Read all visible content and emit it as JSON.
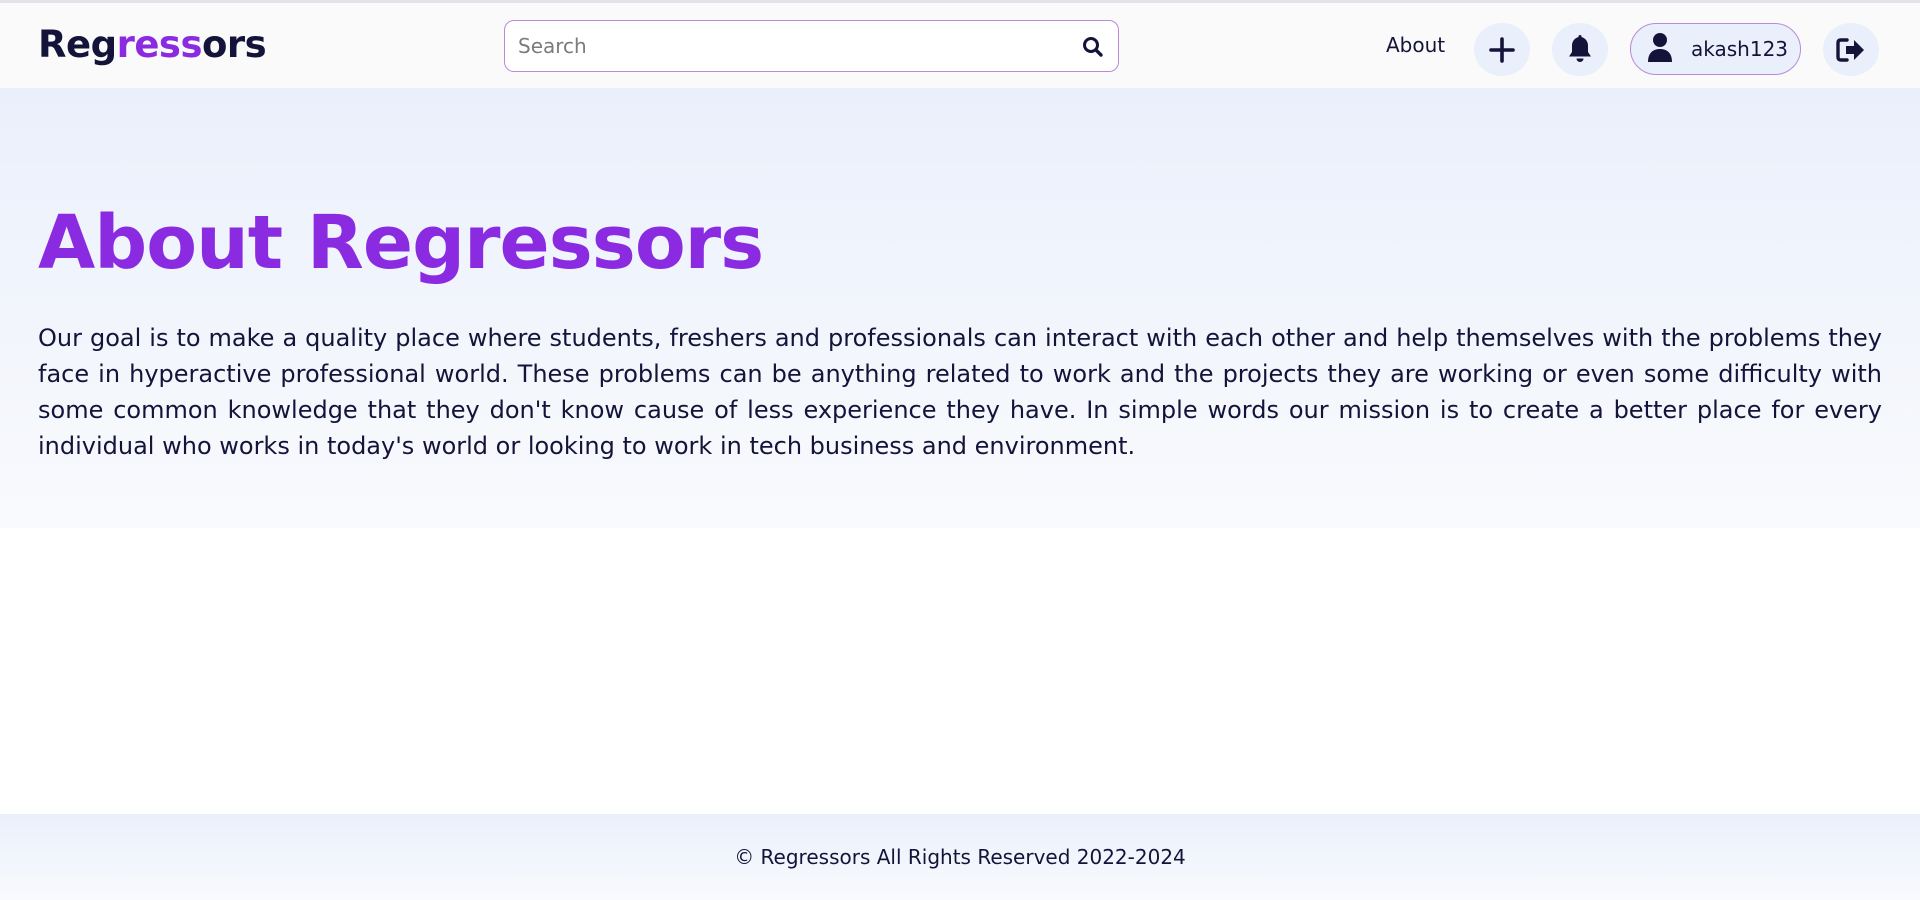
{
  "navbar": {
    "logo": {
      "part1": "Reg",
      "part2": "ress",
      "part3": "ors"
    },
    "search": {
      "placeholder": "Search",
      "value": "",
      "icon": "search-icon"
    },
    "about_label": "About",
    "add_icon": "plus-icon",
    "notifications_icon": "bell-icon",
    "user": {
      "icon": "user-icon",
      "username": "akash123"
    },
    "logout_icon": "sign-out-icon"
  },
  "main": {
    "title": "About Regressors",
    "description": "Our goal is to make a quality place where students, freshers and professionals can interact with each other and help themselves with the problems they face in hyperactive professional world. These problems can be anything related to work and the projects they are working or even some difficulty with some common knowledge that they don't know cause of less experience they have. In simple words our mission is to create a better place for every individual who works in today's world or looking to work in tech business and environment."
  },
  "footer": {
    "copyright": "© Regressors All Rights Reserved 2022-2024"
  },
  "colors": {
    "accent": "#8a2be2",
    "text": "#14143a",
    "navbar_bg": "#fafafa",
    "hero_bg_top": "#eaf0fb",
    "button_bg": "#e9effb"
  }
}
